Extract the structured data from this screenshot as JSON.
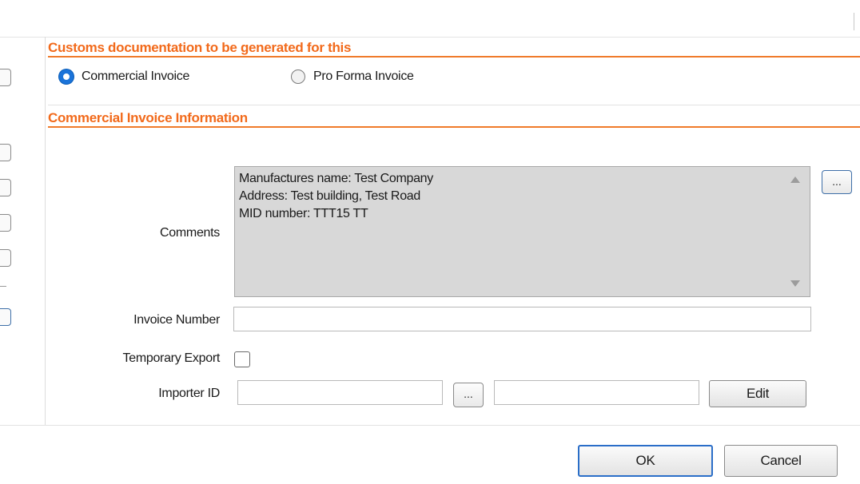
{
  "customs_section": {
    "header": "Customs documentation to be generated for this",
    "options": [
      {
        "label": "Commercial Invoice",
        "selected": true
      },
      {
        "label": "Pro Forma Invoice",
        "selected": false
      }
    ]
  },
  "invoice_section": {
    "header": "Commercial Invoice Information",
    "comments": {
      "label": "Comments",
      "lines": [
        "Manufactures name: Test Company",
        "Address: Test building, Test Road",
        "MID number: TTT15 TT"
      ],
      "browse_label": "..."
    },
    "invoice_number": {
      "label": "Invoice Number",
      "value": ""
    },
    "temporary_export": {
      "label": "Temporary Export",
      "checked": false
    },
    "importer": {
      "label": "Importer ID",
      "id_value": "",
      "browse_label": "...",
      "name_value": "",
      "edit_label": "Edit"
    }
  },
  "dialog_buttons": {
    "ok": "OK",
    "cancel": "Cancel"
  },
  "colors": {
    "section_header": "#f26a1b",
    "section_rule": "#f07a2a",
    "radio_selected": "#1a73d9",
    "comments_bg": "#d8d8d8",
    "default_button_border": "#2a6ec8"
  }
}
